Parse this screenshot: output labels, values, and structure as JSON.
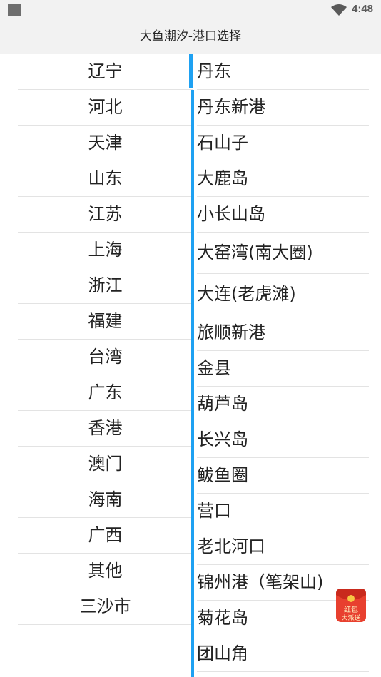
{
  "status": {
    "time": "4:48"
  },
  "app": {
    "title": "大鱼潮汐-港口选择"
  },
  "provinces": [
    "辽宁",
    "河北",
    "天津",
    "山东",
    "江苏",
    "上海",
    "浙江",
    "福建",
    "台湾",
    "广东",
    "香港",
    "澳门",
    "海南",
    "广西",
    "其他",
    "三沙市"
  ],
  "selected_province": "辽宁",
  "ports": [
    "丹东",
    "丹东新港",
    "石山子",
    "大鹿岛",
    "小长山岛",
    "大窑湾(南大圈)",
    "大连(老虎滩)",
    "旅顺新港",
    "金县",
    "葫芦岛",
    "长兴岛",
    "鲅鱼圈",
    "营口",
    "老北河口",
    "锦州港（笔架山)",
    "菊花岛",
    "团山角"
  ],
  "red_packet": {
    "line1": "红包",
    "line2": "大派送"
  },
  "colors": {
    "accent": "#1ea1f2",
    "bar": "#f2f2f2",
    "red": "#e8402f"
  }
}
